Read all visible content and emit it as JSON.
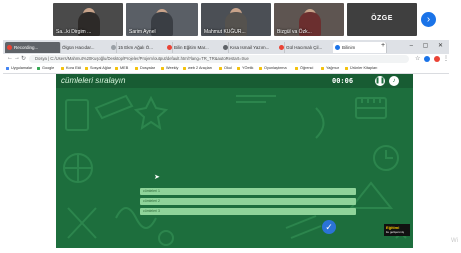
{
  "video": {
    "participants": [
      {
        "name": "Sa...ki Dirgim ..."
      },
      {
        "name": "Sarim Aynel"
      },
      {
        "name": "Mahmut KUĞUR..."
      },
      {
        "name": "Bizgül va Özk..."
      }
    ],
    "active_speaker": "ÖZGE",
    "next_label": "›"
  },
  "browser": {
    "tabs": [
      {
        "label": "Recording..."
      },
      {
        "label": "Ölgün Hacıdar..."
      },
      {
        "label": "15 Ekm Ağalı Ö..."
      },
      {
        "label": "Bilin Eğitim Mar..."
      },
      {
        "label": "Kısa Ismail Yazım..."
      },
      {
        "label": "Gül Hacımalı Çil..."
      },
      {
        "label": "Bilinim"
      }
    ],
    "new_tab": "+",
    "url": "Dosya | C:/Users/Mahmut%20Kuşoğlu/Desktop/Projeler/Projem/output/default.html?lang=TR_TR&autoRestart=true",
    "bookmarks": [
      "Uygulamalar",
      "Google",
      "Kora Ekli",
      "Sosyal Ağlar",
      "MEB",
      "Dosyalar",
      "Weekly",
      "web 2 Araçları",
      "Okul",
      "YÖetik",
      "Oyunlaştırma",
      "Öğrenci",
      "Yağmur",
      "Ürünler Kitapları"
    ]
  },
  "game": {
    "title": "cümleleri sıralayın",
    "timer": "00:06",
    "answers": [
      "cümleleri 1",
      "cümleleri 2",
      "cümleleri 3"
    ],
    "check_label": "✓",
    "logo_line1": "Eğitimi",
    "logo_line2": "ile gelişenmiş"
  },
  "watermark": "Wi"
}
